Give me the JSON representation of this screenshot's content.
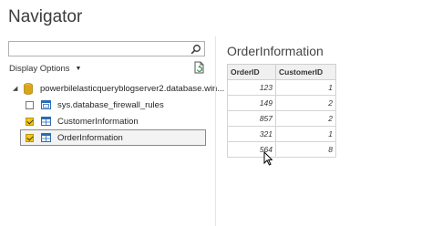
{
  "window": {
    "title": "Navigator"
  },
  "search": {
    "value": "",
    "placeholder": ""
  },
  "options": {
    "display_label": "Display Options",
    "caret": "▼"
  },
  "tree": {
    "server": {
      "label": "powerbilelasticqueryblogserver2.database.win...",
      "expander": "◢"
    },
    "items": [
      {
        "label": "sys.database_firewall_rules",
        "checked": false,
        "selected": false
      },
      {
        "label": "CustomerInformation",
        "checked": true,
        "selected": false
      },
      {
        "label": "OrderInformation",
        "checked": true,
        "selected": true
      }
    ]
  },
  "preview": {
    "title": "OrderInformation",
    "columns": [
      "OrderID",
      "CustomerID"
    ],
    "rows": [
      [
        "123",
        "1"
      ],
      [
        "149",
        "2"
      ],
      [
        "857",
        "2"
      ],
      [
        "321",
        "1"
      ],
      [
        "564",
        "8"
      ]
    ]
  },
  "colors": {
    "checkbox_checked": "#f2c811",
    "db_icon": "#d9a51b",
    "table_icon": "#2b6cb8"
  }
}
